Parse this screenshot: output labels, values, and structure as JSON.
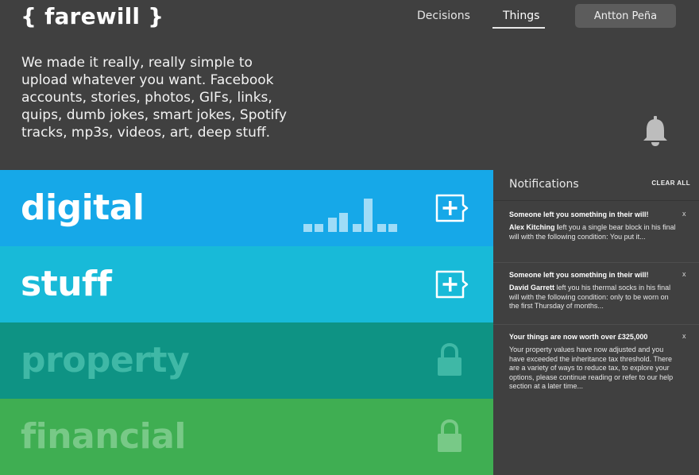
{
  "app": {
    "logo": "{ farewill }"
  },
  "nav": {
    "items": [
      {
        "label": "Decisions",
        "active": false
      },
      {
        "label": "Things",
        "active": true
      }
    ],
    "user_name": "Antton Peña"
  },
  "intro": {
    "text": "We made it really, really simple to upload whatever you want. Facebook accounts, stories, photos, GIFs, links, quips, dumb jokes, smart jokes, Spotify tracks, mp3s, videos, art, deep stuff."
  },
  "categories": [
    {
      "label": "digital",
      "color": "#16a8e8",
      "action": "add-icon",
      "locked": false
    },
    {
      "label": "stuff",
      "color": "#18bad8",
      "action": "add-icon",
      "locked": false
    },
    {
      "label": "property",
      "color": "#0e9384",
      "action": "lock-icon",
      "locked": true
    },
    {
      "label": "financial",
      "color": "#3fae52",
      "action": "lock-icon",
      "locked": true
    }
  ],
  "notifications": {
    "title": "Notifications",
    "clear_all": "CLEAR ALL",
    "close_glyph": "x",
    "items": [
      {
        "title": "Someone left you something in their will!",
        "name": "Alex Kitching",
        "name_suffix": " l",
        "body": "eft you a single bear block in his final will with the following condition: You put it..."
      },
      {
        "title": "Someone left you something in their will!",
        "name": "David Garrett",
        "name_suffix": "",
        "body": " left you his thermal socks in his final will with the following condition: only to be worn on the first Thursday of months..."
      },
      {
        "title": "Your things are now worth over £325,000",
        "name": "",
        "name_suffix": "",
        "body": "Your property values have now adjusted and you have exceeded the inheritance tax threshold. There are a variety of ways to reduce tax, to explore your options, please continue reading or refer to our help section at a later time..."
      }
    ]
  }
}
